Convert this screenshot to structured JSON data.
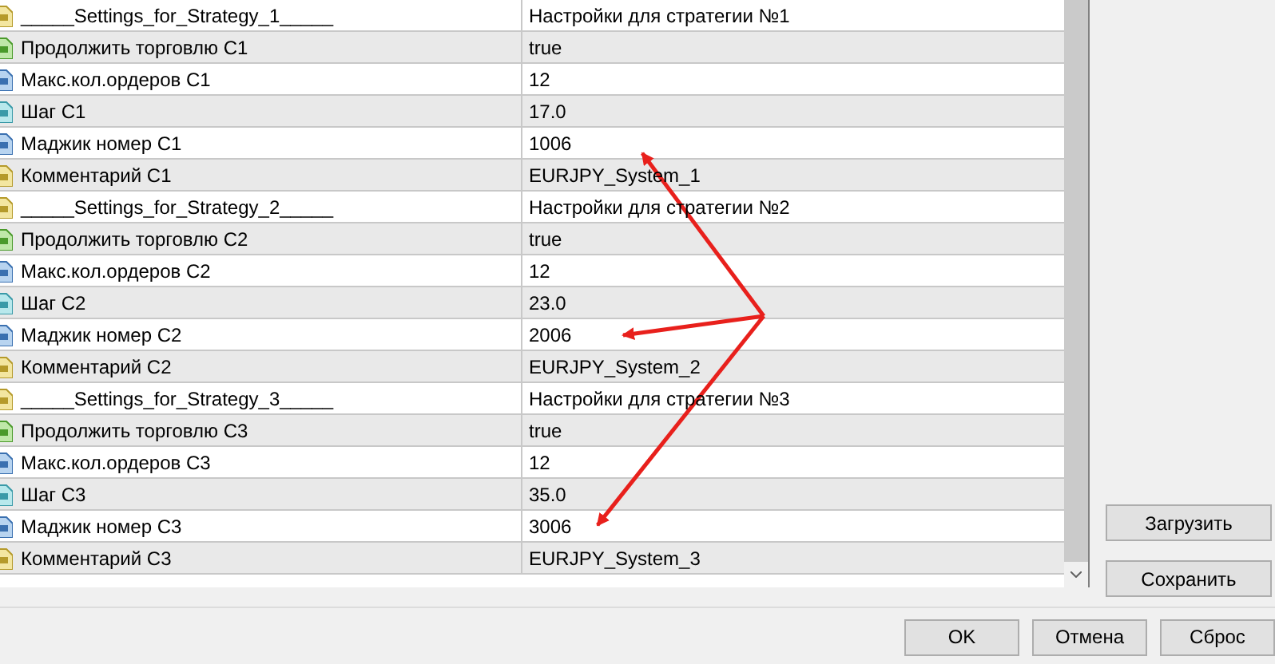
{
  "rows": [
    {
      "kind": "string",
      "name": "_____Settings_for_Strategy_1_____",
      "value": "Настройки для стратегии №1"
    },
    {
      "kind": "bool",
      "name": "Продолжить торговлю C1",
      "value": "true"
    },
    {
      "kind": "int",
      "name": "Макс.кол.ордеров C1",
      "value": "12"
    },
    {
      "kind": "double",
      "name": "Шаг C1",
      "value": "17.0"
    },
    {
      "kind": "int",
      "name": "Маджик номер C1",
      "value": "1006"
    },
    {
      "kind": "string",
      "name": "Комментарий C1",
      "value": "EURJPY_System_1"
    },
    {
      "kind": "string",
      "name": "_____Settings_for_Strategy_2_____",
      "value": "Настройки для стратегии №2"
    },
    {
      "kind": "bool",
      "name": "Продолжить торговлю C2",
      "value": "true"
    },
    {
      "kind": "int",
      "name": "Макс.кол.ордеров C2",
      "value": "12"
    },
    {
      "kind": "double",
      "name": "Шаг C2",
      "value": "23.0"
    },
    {
      "kind": "int",
      "name": "Маджик номер C2",
      "value": "2006"
    },
    {
      "kind": "string",
      "name": "Комментарий C2",
      "value": "EURJPY_System_2"
    },
    {
      "kind": "string",
      "name": "_____Settings_for_Strategy_3_____",
      "value": "Настройки для стратегии №3"
    },
    {
      "kind": "bool",
      "name": "Продолжить торговлю C3",
      "value": "true"
    },
    {
      "kind": "int",
      "name": "Макс.кол.ордеров C3",
      "value": "12"
    },
    {
      "kind": "double",
      "name": "Шаг C3",
      "value": "35.0"
    },
    {
      "kind": "int",
      "name": "Маджик номер C3",
      "value": "3006"
    },
    {
      "kind": "string",
      "name": "Комментарий C3",
      "value": "EURJPY_System_3"
    }
  ],
  "side_buttons": [
    "Загрузить",
    "Сохранить"
  ],
  "buttons": [
    "OK",
    "Отмена",
    "Сброс"
  ]
}
